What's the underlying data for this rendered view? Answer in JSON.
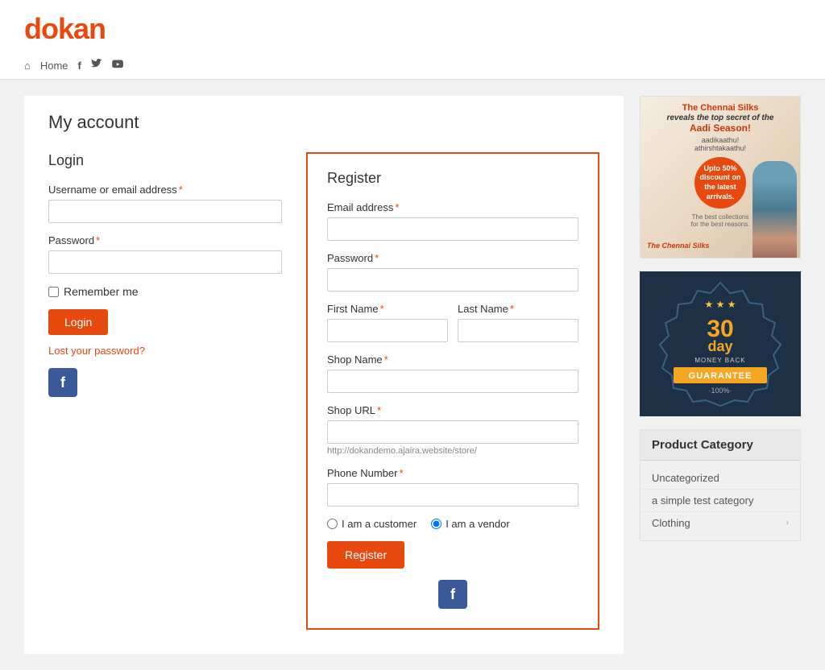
{
  "header": {
    "logo_prefix": "d",
    "logo_suffix": "okan",
    "nav": {
      "home_label": "Home",
      "home_icon": "⌂",
      "facebook_icon": "f",
      "twitter_icon": "🐦",
      "youtube_icon": "▶"
    }
  },
  "page": {
    "title": "My account"
  },
  "login": {
    "section_title": "Login",
    "username_label": "Username or email address",
    "username_required": "*",
    "password_label": "Password",
    "password_required": "*",
    "remember_me_label": "Remember me",
    "login_button": "Login",
    "lost_password_link": "Lost your password?"
  },
  "register": {
    "section_title": "Register",
    "email_label": "Email address",
    "email_required": "*",
    "password_label": "Password",
    "password_required": "*",
    "first_name_label": "First Name",
    "first_name_required": "*",
    "last_name_label": "Last Name",
    "last_name_required": "*",
    "shop_name_label": "Shop Name",
    "shop_name_required": "*",
    "shop_url_label": "Shop URL",
    "shop_url_required": "*",
    "shop_url_hint": "http://dokandemo.ajaira.website/store/",
    "phone_label": "Phone Number",
    "phone_required": "*",
    "customer_label": "I am a customer",
    "vendor_label": "I am a vendor",
    "register_button": "Register"
  },
  "sidebar": {
    "ad1": {
      "headline": "The Chennai Silks",
      "subheadline": "reveals the top secret of the",
      "subheadline2": "Aadi Season!",
      "label1": "aadikaathu!",
      "label2": "athirshtakaathu!",
      "discount": "Upto 50% discount on the latest arrivals.",
      "fine1": "The best collections",
      "fine2": "for the best reasons.",
      "brand": "The Chennai Silks"
    },
    "guarantee": {
      "number": "30",
      "unit": "day",
      "line1": "MONEY BACK",
      "guarantee_text": "GUARANTEE",
      "percent": "·100%·"
    },
    "product_category": {
      "title": "Product Category",
      "items": [
        {
          "label": "Uncategorized",
          "has_arrow": false
        },
        {
          "label": "a simple test category",
          "has_arrow": false
        },
        {
          "label": "Clothing",
          "has_arrow": true
        }
      ]
    }
  }
}
